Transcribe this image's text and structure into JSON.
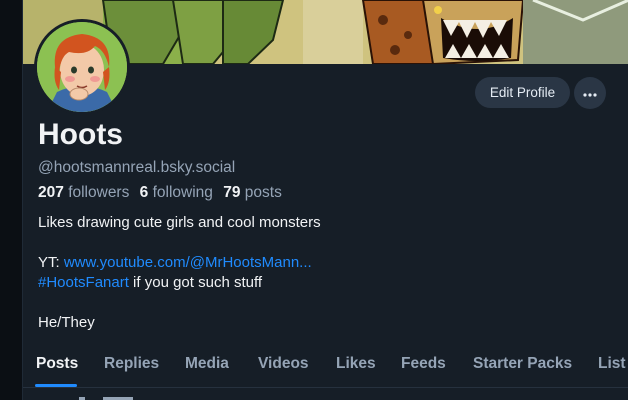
{
  "profile": {
    "display_name": "Hoots",
    "handle": "@hootsmannreal.bsky.social",
    "followers_count": "207",
    "followers_label": "followers",
    "following_count": "6",
    "following_label": "following",
    "posts_count": "79",
    "posts_label": "posts"
  },
  "actions": {
    "edit_label": "Edit Profile",
    "more_label": "···"
  },
  "bio": {
    "line1": "Likes drawing cute girls and cool monsters",
    "yt_prefix": "YT: ",
    "yt_link": "www.youtube.com/@MrHootsMann...",
    "hashtag": "#HootsFanart",
    "hashtag_suffix": " if you got such stuff",
    "pronouns": "He/They"
  },
  "tabs": [
    {
      "label": "Posts",
      "active": true
    },
    {
      "label": "Replies"
    },
    {
      "label": "Media"
    },
    {
      "label": "Videos"
    },
    {
      "label": "Likes"
    },
    {
      "label": "Feeds"
    },
    {
      "label": "Starter Packs"
    },
    {
      "label": "List"
    }
  ],
  "colors": {
    "background": "#161e27",
    "accent": "#208bfe",
    "text_primary": "#f1f3f5",
    "text_secondary": "#95a4b6",
    "button_bg": "#2a3645"
  }
}
